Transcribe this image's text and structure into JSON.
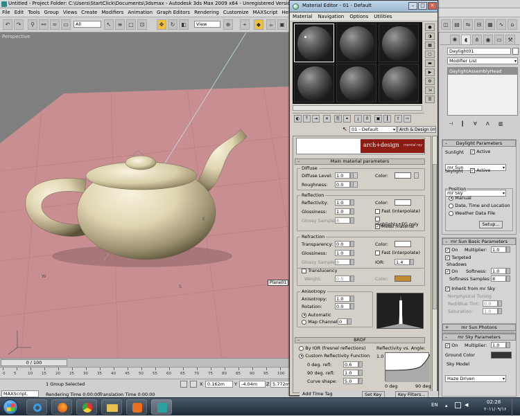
{
  "app": {
    "title": "Untitled    - Project Folder: C:\\Users\\StartClick\\Documents\\3dsmax    - Autodesk 3ds Max  2009 x64    - Unregistered Version",
    "menu": [
      "File",
      "Edit",
      "Tools",
      "Group",
      "Views",
      "Create",
      "Modifiers",
      "Animation",
      "Graph Editors",
      "Rendering",
      "Customize",
      "MAXScript",
      "Help"
    ],
    "toolbar": {
      "selection_filter": "All",
      "coord_system": "View"
    }
  },
  "viewport": {
    "label": "Perspective",
    "object_label": "Plane01",
    "axis_labels": {
      "w": "W",
      "e": "E",
      "s": "S"
    }
  },
  "timeline": {
    "frame_display": "0 / 100",
    "ticks": [
      "0",
      "5",
      "10",
      "15",
      "20",
      "25",
      "30",
      "35",
      "40",
      "45",
      "50",
      "55",
      "60",
      "65",
      "70",
      "75",
      "80",
      "85",
      "90",
      "95",
      "100"
    ]
  },
  "status": {
    "maxscript": "MAXScript.",
    "selection": "1 Group Selected",
    "rendering_time": "Rendering Time  0:00:00",
    "translation_time": "Translation Time  0:00:00",
    "x": "0.162m",
    "y": "-4.04m",
    "z": "5.772m",
    "x_label": "X",
    "y_label": "Y",
    "z_label": "Z",
    "add_time_tag": "Add Time Tag",
    "set_key": "Set Key",
    "key_filters": "Key Filters..."
  },
  "taskbar": {
    "lang": "EN",
    "time": "02:28",
    "date": "۲۰۱۱/۰۹/۱۶"
  },
  "material_editor": {
    "title": "Material Editor - 01 - Default",
    "menu": [
      "Material",
      "Navigation",
      "Options",
      "Utilities"
    ],
    "material_name": "01 - Default",
    "material_type": "Arch & Design (mi)",
    "banner_text": "arch+design",
    "banner_sub": "mental ray",
    "main_rollout": "Main material parameters",
    "diffuse": {
      "group": "Diffuse",
      "level_label": "Diffuse Level:",
      "level": "1.0",
      "roughness_label": "Roughness:",
      "roughness": "0.0",
      "color_label": "Color:"
    },
    "reflection": {
      "group": "Reflection",
      "reflectivity_label": "Reflectivity:",
      "reflectivity": "1.0",
      "glossiness_label": "Glossiness:",
      "glossiness": "1.0",
      "glossy_samples_label": "Glossy Samples:",
      "glossy_samples": "8",
      "color_label": "Color:",
      "fast": "Fast (interpolate)",
      "highlights": "Highlights+FG only",
      "metal": "Metal material"
    },
    "refraction": {
      "group": "Refraction",
      "transparency_label": "Transparency:",
      "transparency": "0.0",
      "glossiness_label": "Glossiness:",
      "glossiness": "1.0",
      "glossy_samples_label": "Glossy Samples:",
      "glossy_samples": "8",
      "color_label": "Color:",
      "fast": "Fast (interpolate)",
      "ior_label": "IOR:",
      "ior": "1.4"
    },
    "translucency": {
      "label": "Translucency",
      "weight_label": "Weight:",
      "weight": "0.5",
      "color_label": "Color:"
    },
    "anisotropy": {
      "group": "Anisotropy",
      "anisotropy_label": "Anisotropy:",
      "anisotropy": "1.0",
      "rotation_label": "Rotation:",
      "rotation": "0.0",
      "automatic": "Automatic",
      "map_channel": "Map Channel:",
      "map_channel_value": "0"
    },
    "brdf": {
      "rollout": "BRDF",
      "by_ior": "By IOR (fresnel reflections)",
      "custom": "Custom Reflectivity Function",
      "deg0_label": "0 deg. refl:",
      "deg0": "0.6",
      "deg90_label": "90 deg. refl:",
      "deg90": "1.0",
      "curve_label": "Curve shape:",
      "curve": "5.0",
      "graph_title": "Reflectivity vs. Angle:",
      "y_top": "1.0",
      "x_left": "0 deg",
      "x_right": "90 deg"
    }
  },
  "command_panel": {
    "object_name": "Daylight01",
    "modifier_list": "Modifier List",
    "stack_item": "DaylightAssemblyHead",
    "daylight": {
      "rollout": "Daylight Parameters",
      "sunlight": "Sunlight",
      "active": "Active",
      "sun_type": "mr Sun",
      "skylight": "Skylight",
      "sky_active": "Active",
      "sky_type": "mr Sky",
      "position": "Position",
      "manual": "Manual",
      "date_time": "Date, Time and Location",
      "weather": "Weather Data File",
      "setup": "Setup..."
    },
    "sun_basic": {
      "rollout": "mr Sun Basic Parameters",
      "on": "On",
      "multiplier_label": "Multiplier:",
      "multiplier": "1.0",
      "targeted": "Targeted",
      "shadows": "Shadows",
      "shadows_on": "On",
      "softness_label": "Softness:",
      "softness": "1.0",
      "samples_label": "Softness Samples:",
      "samples": "8",
      "inherit": "Inherit from mr Sky",
      "nonphys": "Nonphysical Tuning",
      "redblue_label": "Red/Blue Tint:",
      "redblue": "0.0",
      "saturation_label": "Saturation:",
      "saturation": "1.0"
    },
    "sun_photons": {
      "rollout": "mr Sun Photons"
    },
    "sky": {
      "rollout": "mr Sky Parameters",
      "on": "On",
      "multiplier_label": "Multiplier:",
      "multiplier": "1.0",
      "ground_label": "Ground Color",
      "model_label": "Sky Model",
      "model": "Haze Driven"
    }
  }
}
